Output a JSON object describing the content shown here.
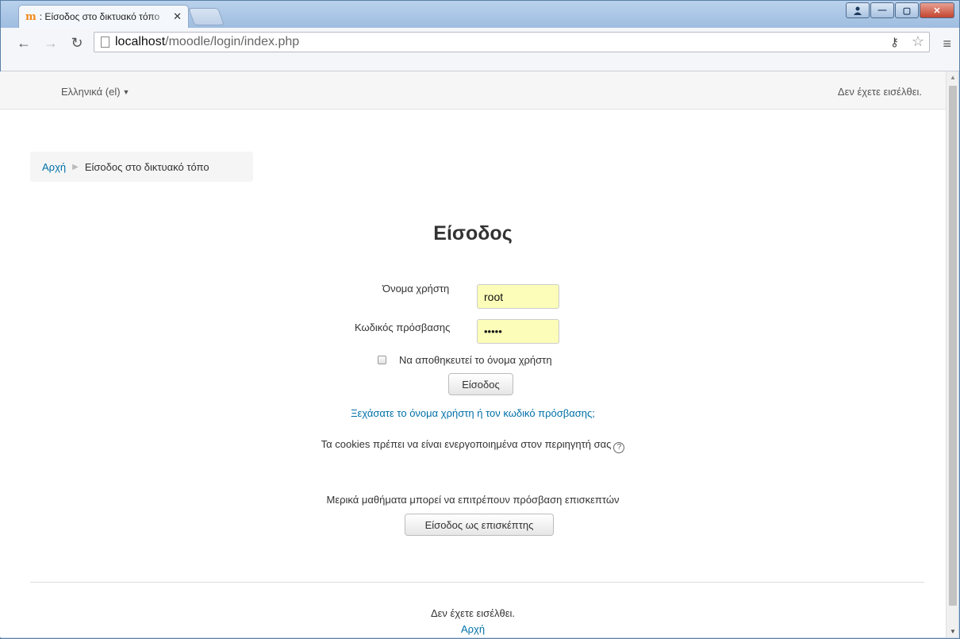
{
  "browser": {
    "tab_favicon": "m",
    "tab_title": ": Είσοδος στο δικτυακό τόπο",
    "tab_close": "✕",
    "url_host": "localhost",
    "url_path": "/moodle/login/index.php",
    "window_buttons": {
      "user": "👤",
      "minimize": "—",
      "maximize": "▢",
      "close": "✕"
    }
  },
  "header": {
    "language": "Ελληνικά (el)",
    "login_status": "Δεν έχετε εισέλθει."
  },
  "breadcrumb": {
    "home": "Αρχή",
    "current": "Είσοδος στο δικτυακό τόπο"
  },
  "login": {
    "title": "Είσοδος",
    "username_label": "Όνομα χρήστη",
    "username_value": "root",
    "password_label": "Κωδικός πρόσβασης",
    "password_value": "•••••",
    "remember_label": "Να αποθηκευτεί το όνομα χρήστη",
    "remember_checked": false,
    "login_button": "Είσοδος",
    "forgot_link": "Ξεχάσατε το όνομα χρήστη ή τον κωδικό πρόσβασης;",
    "cookies_notice": "Τα cookies πρέπει να είναι ενεργοποιημένα στον περιηγητή σας",
    "guest_notice": "Μερικά μαθήματα μπορεί να επιτρέπουν πρόσβαση επισκεπτών",
    "guest_button": "Είσοδος ως επισκέπτης"
  },
  "footer": {
    "login_status": "Δεν έχετε εισέλθει.",
    "home_link": "Αρχή"
  },
  "colors": {
    "link": "#0070a8",
    "autofill_bg": "#fbfdb9",
    "favicon": "#f2891b"
  }
}
